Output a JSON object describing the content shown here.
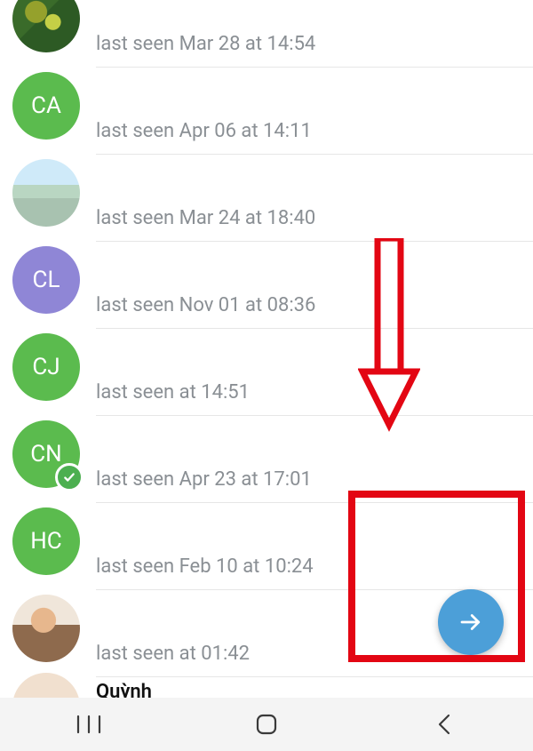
{
  "contacts": [
    {
      "initials": "",
      "avatar_type": "photo1",
      "checked": false,
      "name": "",
      "status": "last seen Mar 28 at 14:54"
    },
    {
      "initials": "CA",
      "avatar_type": "green",
      "checked": false,
      "name": "",
      "status": "last seen Apr 06 at 14:11"
    },
    {
      "initials": "",
      "avatar_type": "photo2",
      "checked": false,
      "name": "",
      "status": "last seen Mar 24 at 18:40"
    },
    {
      "initials": "CL",
      "avatar_type": "purple",
      "checked": false,
      "name": "",
      "status": "last seen Nov 01 at 08:36"
    },
    {
      "initials": "CJ",
      "avatar_type": "green",
      "checked": false,
      "name": "",
      "status": "last seen at 14:51"
    },
    {
      "initials": "CN",
      "avatar_type": "green",
      "checked": true,
      "name": "",
      "status": "last seen Apr 23 at 17:01"
    },
    {
      "initials": "HC",
      "avatar_type": "green",
      "checked": false,
      "name": "",
      "status": "last seen Feb 10 at 10:24"
    },
    {
      "initials": "",
      "avatar_type": "photo3",
      "checked": false,
      "name": "",
      "status": "last seen at 01:42"
    },
    {
      "initials": "",
      "avatar_type": "photo4",
      "checked": false,
      "name": "Quỳnh",
      "status": ""
    }
  ],
  "fab": {
    "icon": "arrow-right"
  },
  "colors": {
    "accent_fab": "#4c9fd8",
    "annotation": "#e30613",
    "avatar_green": "#5bbb4e",
    "avatar_purple": "#8f86d6"
  },
  "annotation": {
    "arrow": true,
    "box_around_fab": true
  },
  "nav": {
    "recent": "recent-apps",
    "home": "home",
    "back": "back"
  }
}
